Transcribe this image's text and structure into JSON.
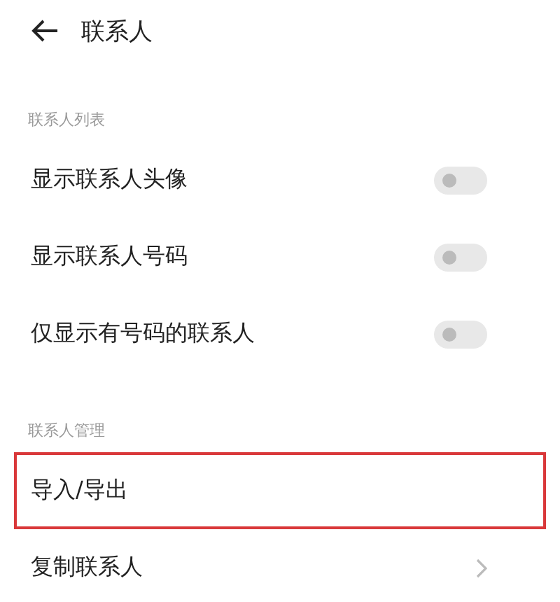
{
  "header": {
    "title": "联系人"
  },
  "sections": [
    {
      "title": "联系人列表",
      "items": [
        {
          "kind": "toggle",
          "label": "显示联系人头像",
          "on": false,
          "highlighted": false
        },
        {
          "kind": "toggle",
          "label": "显示联系人号码",
          "on": false,
          "highlighted": false
        },
        {
          "kind": "toggle",
          "label": "仅显示有号码的联系人",
          "on": false,
          "highlighted": false
        }
      ]
    },
    {
      "title": "联系人管理",
      "items": [
        {
          "kind": "link",
          "label": "导入/导出",
          "highlighted": true
        },
        {
          "kind": "link",
          "label": "复制联系人",
          "highlighted": false
        }
      ]
    }
  ]
}
